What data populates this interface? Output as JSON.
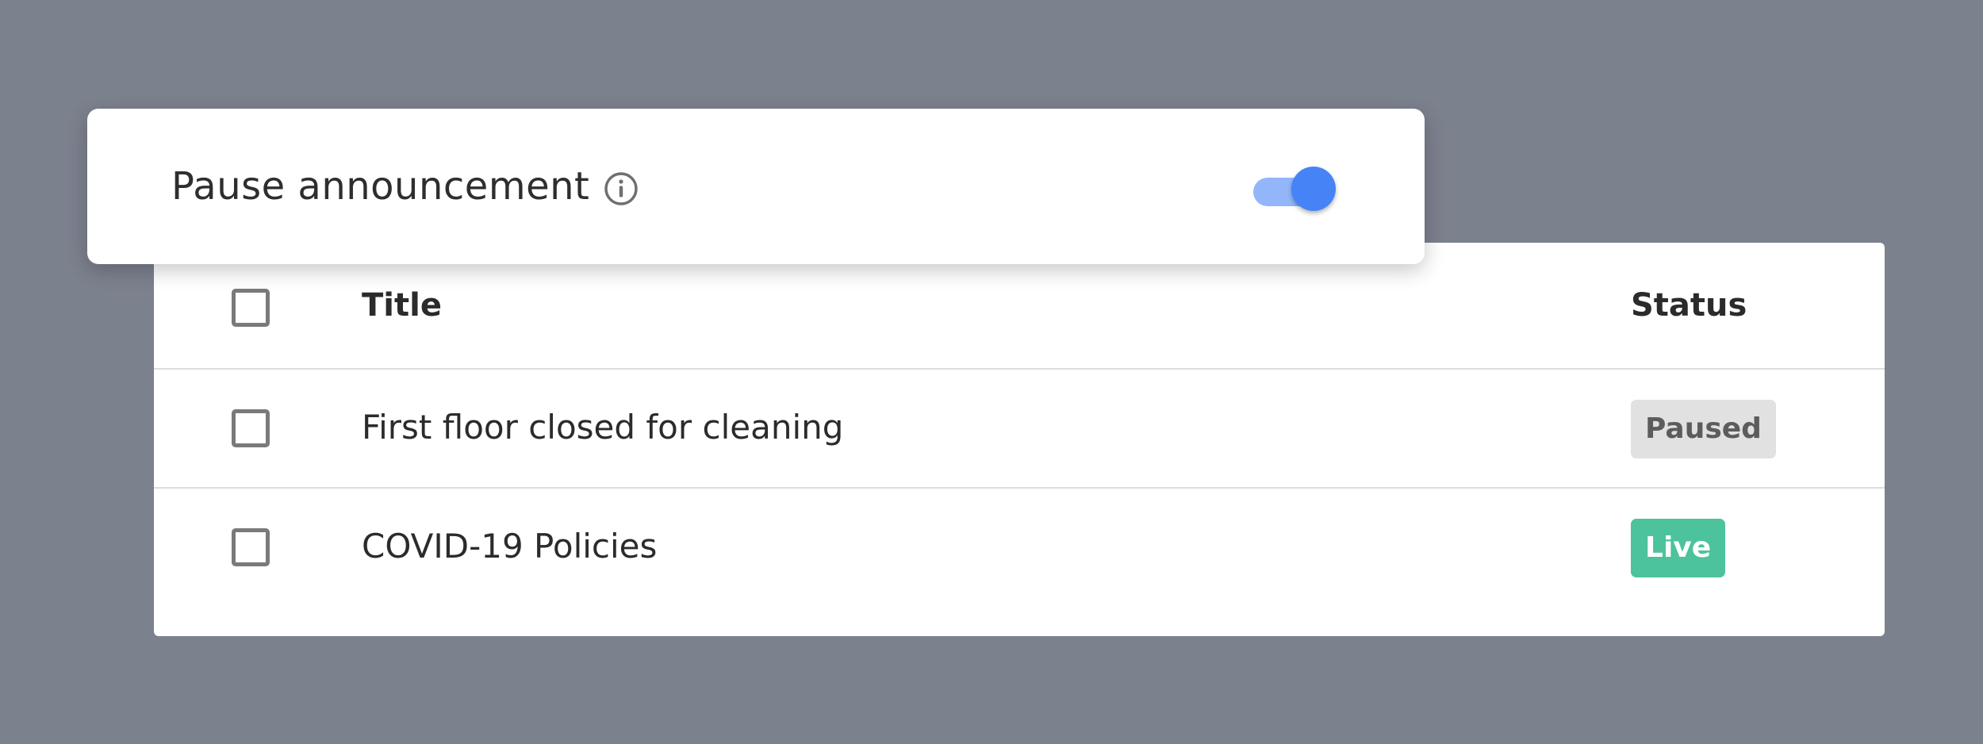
{
  "pause_card": {
    "label": "Pause announcement",
    "info_icon": "info-icon",
    "toggle_on": true
  },
  "table": {
    "columns": {
      "title": "Title",
      "status": "Status"
    },
    "rows": [
      {
        "title": "First floor closed for cleaning",
        "status": "Paused",
        "checked": false
      },
      {
        "title": "COVID-19 Policies",
        "status": "Live",
        "checked": false
      }
    ]
  },
  "colors": {
    "background": "#7c818e",
    "toggle_accent": "#4683f6",
    "paused_badge": "#e1e1e1",
    "live_badge": "#4cc39c"
  }
}
